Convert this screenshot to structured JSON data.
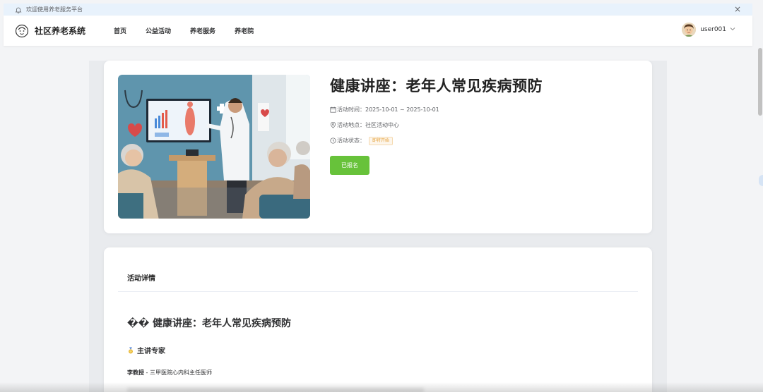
{
  "notice": {
    "text": "欢迎使用养老服务平台",
    "close": "×"
  },
  "navbar": {
    "brand": "社区养老系统",
    "menu": [
      "首页",
      "公益活动",
      "养老服务",
      "养老院"
    ],
    "user": "user001"
  },
  "activity": {
    "title": "健康讲座：老年人常见疾病预防",
    "time_label": "活动时间：",
    "time_value": "2025-10-01 ~ 2025-10-01",
    "location_label": "活动地点：",
    "location_value": "社区活动中心",
    "status_label": "活动状态：",
    "status_value": "即将开始",
    "button": "已报名"
  },
  "details": {
    "heading": "活动详情",
    "title": "�� 健康讲座：老年人常见疾病预防",
    "expert_heading": "主讲专家",
    "expert_name": "李教授",
    "expert_desc": " - 三甲医院心内科主任医师"
  },
  "colors": {
    "accent_green": "#67c23a",
    "notice_bg": "#e8f2fc",
    "badge_orange": "#e6a23c"
  }
}
